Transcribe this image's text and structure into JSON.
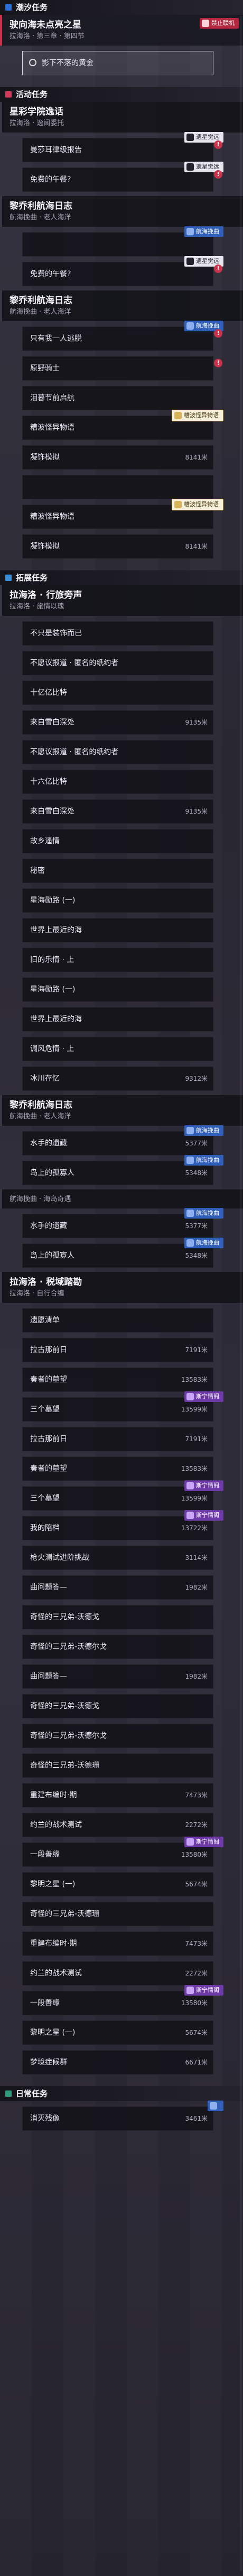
{
  "colors": {
    "rare": "#2b6fd8",
    "active": "#d23b5a",
    "main": "#3a8fd6",
    "daily": "#2f9b7c"
  },
  "sections": [
    {
      "header": "潮汐任务",
      "square_color": "#2b6fd8",
      "quests": [
        {
          "title": "驶向海未点亮之星",
          "subtitle": "拉海洛 · 第三章 · 第四节",
          "active": true,
          "tag": {
            "label": "禁止联机",
            "style": "red"
          },
          "steps": [
            {
              "text": "影下不落的黄金",
              "selected": true
            }
          ]
        }
      ]
    },
    {
      "header": "活动任务",
      "square_color": "#d23b5a",
      "quests": [
        {
          "title": "星彩学院逸话",
          "subtitle": "拉海洛 · 逸闻委托",
          "steps": [
            {
              "text": "曼莎耳律级报告",
              "tag": {
                "label": "遗星觉远",
                "style": "grey"
              },
              "bang": true
            },
            {
              "text": "免费的午餐?",
              "tag": {
                "label": "遗星觉远",
                "style": "grey"
              },
              "bang": true
            }
          ]
        },
        {
          "title": "黎乔利航海日志",
          "subtitle": "航海挽曲 · 老人海洋",
          "steps": [
            {
              "text": "",
              "tag": {
                "label": "航海挽曲",
                "style": "blue"
              }
            },
            {
              "text": "免费的午餐?",
              "tag": {
                "label": "遗星觉远",
                "style": "grey"
              },
              "bang": true
            }
          ]
        },
        {
          "title": "黎乔利航海日志",
          "subtitle": "航海挽曲 · 老人海洋",
          "steps": [
            {
              "text": "只有我一人逃脱",
              "tag": {
                "label": "航海挽曲",
                "style": "blue"
              },
              "bang": true
            },
            {
              "text": "原野骑士",
              "bang": true
            },
            {
              "text": "泪暮节前启航"
            },
            {
              "text": "糟波怪异物语",
              "tag": {
                "label": "糟波怪异物语",
                "style": "gold"
              }
            },
            {
              "text": "凝饰模拟",
              "meta": "8141米"
            }
          ]
        },
        {
          "title": "",
          "subtitle": "",
          "steps": [
            {
              "text": "",
              "red": true
            },
            {
              "text": "糟波怪异物语",
              "tag": {
                "label": "糟波怪异物语",
                "style": "gold"
              }
            },
            {
              "text": "凝饰模拟",
              "meta": "8141米"
            }
          ]
        }
      ]
    },
    {
      "header": "拓展任务",
      "square_color": "#3a8fd6",
      "quests": [
        {
          "title": "拉海洛 · 行旅旁声",
          "subtitle": "拉海洛 · 旅情以瑰",
          "steps": [
            {
              "text": "不只是装饰而已"
            },
            {
              "text": "不愿议报道 · 匿名的纸约者"
            },
            {
              "text": "十亿亿比特"
            },
            {
              "text": "来自雪白深处",
              "meta": "9135米"
            },
            {
              "text": "不愿议报道 · 匿名的纸约者"
            },
            {
              "text": "十六亿比特"
            },
            {
              "text": "来自雪白深处",
              "meta": "9135米"
            },
            {
              "text": "故乡遥情"
            },
            {
              "text": "秘密"
            },
            {
              "text": "星海勋路 (一)"
            },
            {
              "text": "世界上最近的海"
            },
            {
              "text": "旧的乐情 · 上"
            },
            {
              "text": "星海勋路 (一)"
            },
            {
              "text": "世界上最近的海"
            },
            {
              "text": "调风危情 · 上"
            },
            {
              "text": "冰川存忆",
              "meta": "9312米"
            }
          ]
        },
        {
          "title": "黎乔利航海日志",
          "subtitle": "航海挽曲 · 老人海洋",
          "steps": [
            {
              "text": "水手的遗藏",
              "meta": "5377米",
              "tag": {
                "label": "航海挽曲",
                "style": "blue"
              }
            },
            {
              "text": "岛上的孤寡人",
              "meta": "5348米",
              "tag": {
                "label": "航海挽曲",
                "style": "blue"
              }
            }
          ]
        },
        {
          "title": "",
          "subtitle": "航海挽曲 · 海岛奇遇",
          "steps": [
            {
              "text": "水手的遗藏",
              "meta": "5377米",
              "tag": {
                "label": "航海挽曲",
                "style": "blue"
              }
            },
            {
              "text": "岛上的孤寡人",
              "meta": "5348米",
              "tag": {
                "label": "航海挽曲",
                "style": "blue"
              }
            }
          ]
        },
        {
          "title": "拉海洛 · 税域踏勘",
          "subtitle": "拉海洛 · 自行合编",
          "steps": [
            {
              "text": "遗愿清单"
            },
            {
              "text": "拉古那前日",
              "meta": "7191米"
            },
            {
              "text": "奏者的墓望",
              "meta": "13583米"
            },
            {
              "text": "三个墓望",
              "meta": "13599米",
              "tag": {
                "label": "斯宁情阁",
                "style": "purple"
              }
            },
            {
              "text": "拉古那前日",
              "meta": "7191米"
            },
            {
              "text": "奏者的墓望",
              "meta": "13583米"
            },
            {
              "text": "三个墓望",
              "meta": "13599米",
              "tag": {
                "label": "斯宁情阁",
                "style": "purple"
              }
            },
            {
              "text": "我的陪档",
              "meta": "13722米",
              "tag": {
                "label": "斯宁情阁",
                "style": "purple"
              }
            },
            {
              "text": "枪火测试进阶挑战",
              "meta": "3114米"
            },
            {
              "text": "曲问题答—",
              "meta": "1982米"
            },
            {
              "text": "奇怪的三兄弟-沃德戈"
            },
            {
              "text": "奇怪的三兄弟-沃德尔戈"
            },
            {
              "text": "曲问题答—",
              "meta": "1982米"
            },
            {
              "text": "奇怪的三兄弟-沃德戈"
            },
            {
              "text": "奇怪的三兄弟-沃德尔戈"
            },
            {
              "text": "奇怪的三兄弟-沃德珊"
            },
            {
              "text": "重建布编时·期",
              "meta": "7473米"
            },
            {
              "text": "约兰的战术测试",
              "meta": "2272米"
            },
            {
              "text": "一段善缘",
              "meta": "13580米",
              "tag": {
                "label": "斯宁情阁",
                "style": "purple"
              }
            },
            {
              "text": "黎明之星 (一)",
              "meta": "5674米"
            },
            {
              "text": "奇怪的三兄弟-沃德珊"
            },
            {
              "text": "重建布编时·期",
              "meta": "7473米"
            },
            {
              "text": "约兰的战术测试",
              "meta": "2272米"
            },
            {
              "text": "一段善缘",
              "meta": "13580米",
              "tag": {
                "label": "斯宁情阁",
                "style": "purple"
              }
            },
            {
              "text": "黎明之星 (一)",
              "meta": "5674米"
            },
            {
              "text": "梦境症候群",
              "meta": "6671米"
            }
          ]
        }
      ]
    },
    {
      "header": "日常任务",
      "square_color": "#2f9b7c",
      "quests": [
        {
          "title": "",
          "subtitle": "",
          "steps": [
            {
              "text": "消灭残像",
              "meta": "3461米",
              "tag": {
                "label": "",
                "style": "blue"
              }
            }
          ]
        }
      ]
    }
  ]
}
